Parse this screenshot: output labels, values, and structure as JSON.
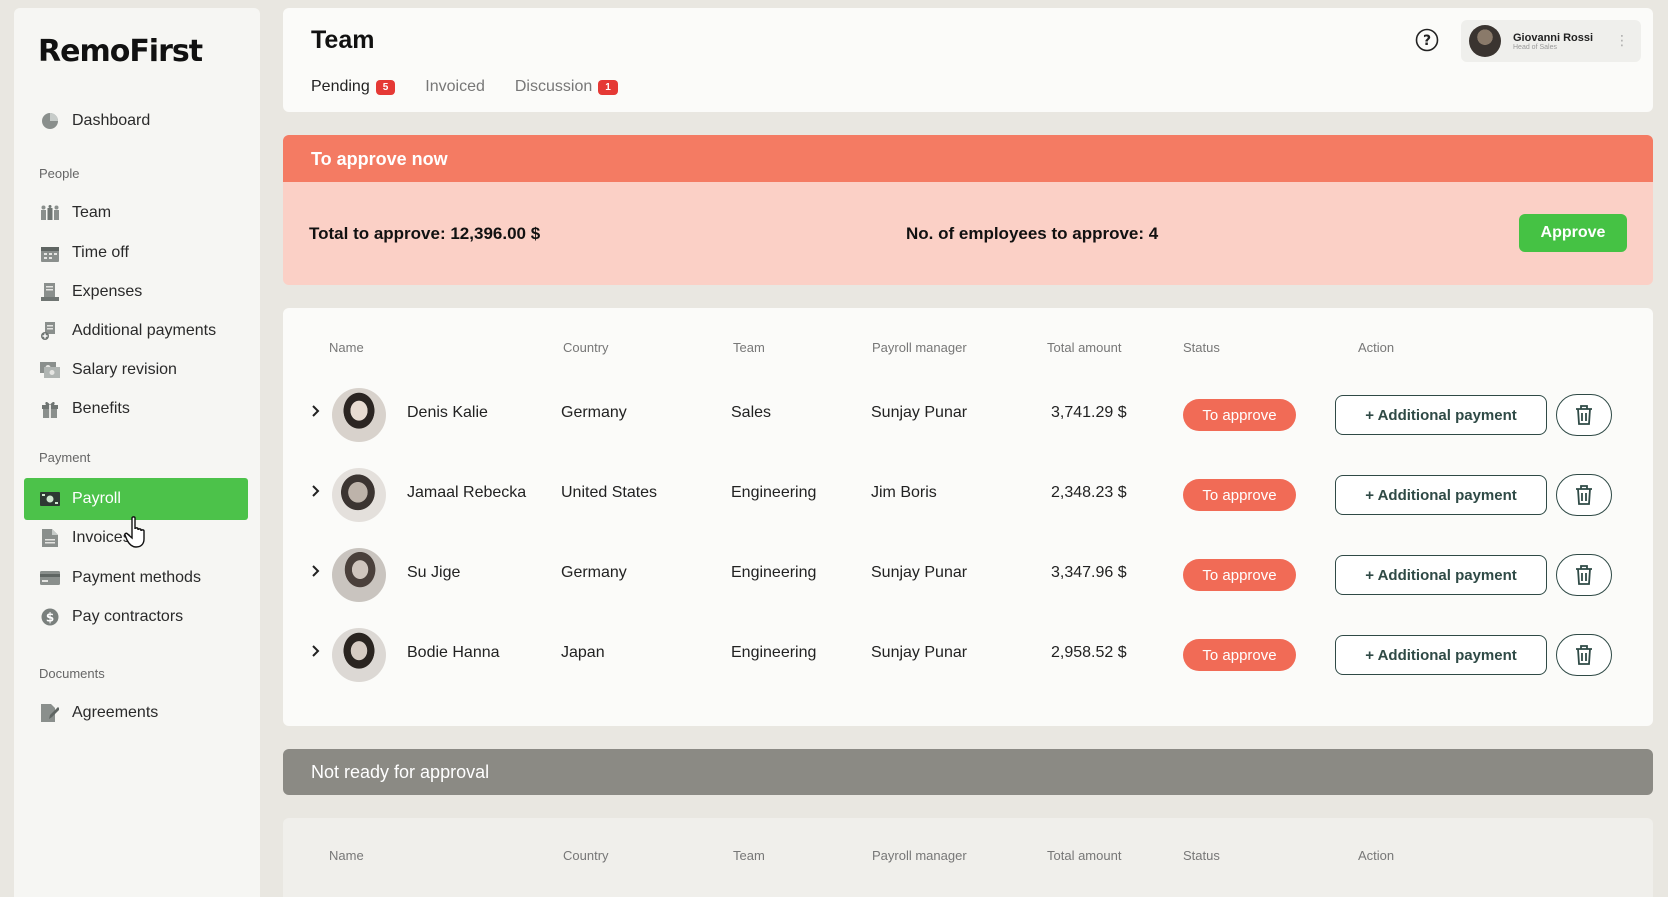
{
  "brand": {
    "logo_text": "RemoFirst"
  },
  "sidebar": {
    "dashboard": "Dashboard",
    "sections": {
      "people": "People",
      "payment": "Payment",
      "documents": "Documents"
    },
    "people_items": [
      "Team",
      "Time off",
      "Expenses",
      "Additional payments",
      "Salary revision",
      "Benefits"
    ],
    "payment_items": [
      "Payroll",
      "Invoices",
      "Payment methods",
      "Pay contractors"
    ],
    "documents_items": [
      "Agreements"
    ],
    "active_item": "Payroll",
    "active_color": "#4cc24a"
  },
  "header": {
    "title": "Team",
    "tabs": [
      {
        "label": "Pending",
        "badge": "5"
      },
      {
        "label": "Invoiced",
        "badge": ""
      },
      {
        "label": "Discussion",
        "badge": "1"
      }
    ],
    "user": {
      "name": "Giovanni Rossi",
      "role": "Head of Sales"
    }
  },
  "approve_section": {
    "title": "To approve now",
    "total_label": "Total to approve: 12,396.00 $",
    "count_label": "No. of employees to approve: 4",
    "approve_button": "Approve",
    "header_color": "#f47b63",
    "body_color": "#fbd0c6"
  },
  "table": {
    "columns": [
      "Name",
      "Country",
      "Team",
      "Payroll manager",
      "Total amount",
      "Status",
      "Action"
    ],
    "rows": [
      {
        "name": "Denis Kalie",
        "country": "Germany",
        "team": "Sales",
        "manager": "Sunjay Punar",
        "amount": "3,741.29 $",
        "status": "To approve",
        "action": "+ Additional payment"
      },
      {
        "name": "Jamaal Rebecka",
        "country": "United States",
        "team": "Engineering",
        "manager": "Jim Boris",
        "amount": "2,348.23 $",
        "status": "To approve",
        "action": "+ Additional payment"
      },
      {
        "name": "Su Jige",
        "country": "Germany",
        "team": "Engineering",
        "manager": "Sunjay Punar",
        "amount": "3,347.96 $",
        "status": "To approve",
        "action": "+ Additional payment"
      },
      {
        "name": "Bodie Hanna",
        "country": "Japan",
        "team": "Engineering",
        "manager": "Sunjay Punar",
        "amount": "2,958.52 $",
        "status": "To approve",
        "action": "+ Additional payment"
      }
    ]
  },
  "not_ready_section": {
    "title": "Not ready for approval",
    "columns": [
      "Name",
      "Country",
      "Team",
      "Payroll manager",
      "Total amount",
      "Status",
      "Action"
    ]
  },
  "icons": {
    "dashboard": "pie-chart-icon",
    "team": "group-icon",
    "time_off": "calendar-icon",
    "expenses": "receipt-icon",
    "additional_payments": "money-add-icon",
    "salary_revision": "salary-icon",
    "benefits": "gift-icon",
    "payroll": "cash-icon",
    "invoices": "document-icon",
    "payment_methods": "credit-card-icon",
    "pay_contractors": "dollar-coin-icon",
    "agreements": "edit-document-icon",
    "help": "question-icon",
    "delete": "trash-icon",
    "expand": "chevron-right-icon"
  }
}
